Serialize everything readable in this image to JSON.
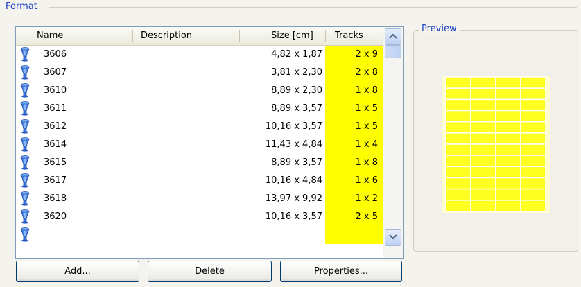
{
  "format_group": {
    "label_accel": "F",
    "label_rest": "ormat"
  },
  "columns": {
    "name": "Name",
    "description": "Description",
    "size": "Size [cm]",
    "tracks": "Tracks"
  },
  "rows": [
    {
      "name": "3606",
      "description": "",
      "size": "4,82 x 1,87",
      "tracks": "2 x 9"
    },
    {
      "name": "3607",
      "description": "",
      "size": "3,81 x 2,30",
      "tracks": "2 x 8"
    },
    {
      "name": "3610",
      "description": "",
      "size": "8,89 x 2,30",
      "tracks": "1 x 8"
    },
    {
      "name": "3611",
      "description": "",
      "size": "8,89 x 3,57",
      "tracks": "1 x 5"
    },
    {
      "name": "3612",
      "description": "",
      "size": "10,16 x 3,57",
      "tracks": "1 x 5"
    },
    {
      "name": "3614",
      "description": "",
      "size": "11,43 x 4,84",
      "tracks": "1 x 4"
    },
    {
      "name": "3615",
      "description": "",
      "size": "8,89 x 3,57",
      "tracks": "1 x 8"
    },
    {
      "name": "3617",
      "description": "",
      "size": "10,16 x 4,84",
      "tracks": "1 x 6"
    },
    {
      "name": "3618",
      "description": "",
      "size": "13,97 x 9,92",
      "tracks": "1 x 2"
    },
    {
      "name": "3620",
      "description": "",
      "size": "10,16 x 3,57",
      "tracks": "2 x 5"
    }
  ],
  "preview": {
    "label": "Preview",
    "grid_cols": 4,
    "grid_rows": 12
  },
  "buttons": {
    "add": "Add...",
    "delete": "Delete",
    "properties": "Properties..."
  },
  "colors": {
    "tracks_highlight": "#ffff00",
    "group_label": "#1a3fc4",
    "preview_paper": "#fffcd0"
  }
}
